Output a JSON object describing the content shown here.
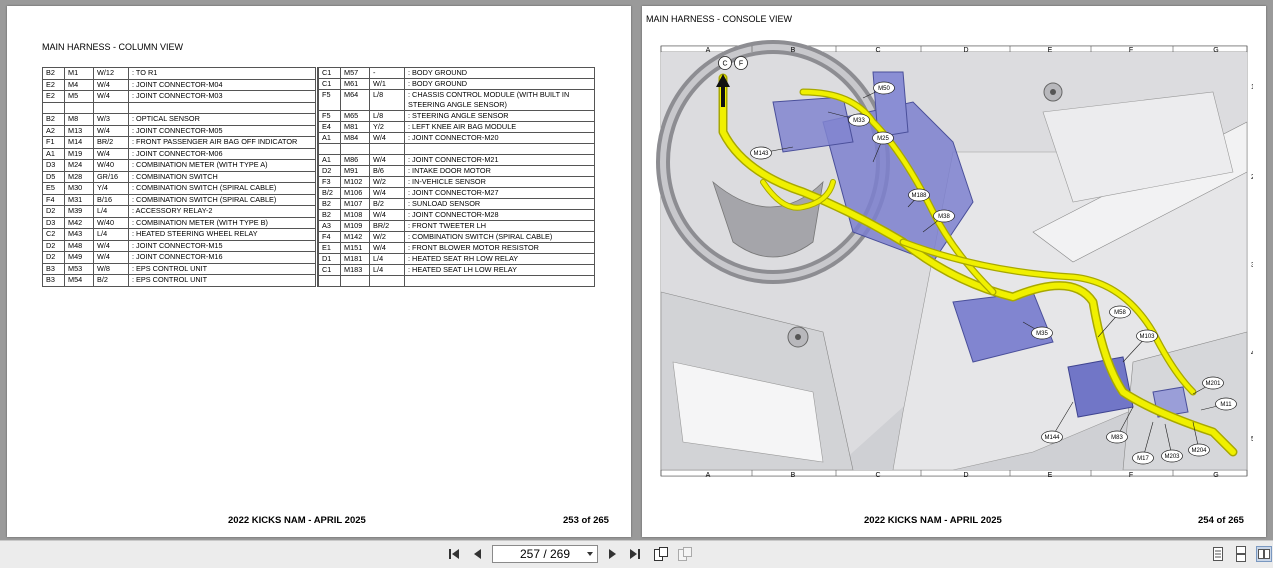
{
  "left_page": {
    "title": "MAIN HARNESS - COLUMN VIEW",
    "footer_title": "2022 KICKS NAM - APRIL 2025",
    "footer_page": "253 of 265",
    "table_left": [
      [
        "B2",
        "M1",
        "W/12",
        ": TO R1"
      ],
      [
        "E2",
        "M4",
        "W/4",
        ": JOINT CONNECTOR-M04"
      ],
      [
        "E2",
        "M5",
        "W/4",
        ": JOINT CONNECTOR-M03"
      ],
      [
        "",
        "",
        "",
        ""
      ],
      [
        "B2",
        "M8",
        "W/3",
        ": OPTICAL SENSOR"
      ],
      [
        "A2",
        "M13",
        "W/4",
        ": JOINT CONNECTOR-M05"
      ],
      [
        "F1",
        "M14",
        "BR/2",
        ": FRONT PASSENGER AIR BAG OFF INDICATOR"
      ],
      [
        "A1",
        "M19",
        "W/4",
        ": JOINT CONNECTOR-M06"
      ],
      [
        "D3",
        "M24",
        "W/40",
        ": COMBINATION METER (WITH TYPE A)"
      ],
      [
        "D5",
        "M28",
        "GR/16",
        ": COMBINATION SWITCH"
      ],
      [
        "E5",
        "M30",
        "Y/4",
        ": COMBINATION SWITCH (SPIRAL CABLE)"
      ],
      [
        "F4",
        "M31",
        "B/16",
        ": COMBINATION SWITCH (SPIRAL CABLE)"
      ],
      [
        "D2",
        "M39",
        "L/4",
        ": ACCESSORY RELAY-2"
      ],
      [
        "D3",
        "M42",
        "W/40",
        ": COMBINATION METER (WITH TYPE B)"
      ],
      [
        "C2",
        "M43",
        "L/4",
        ": HEATED STEERING WHEEL RELAY"
      ],
      [
        "D2",
        "M48",
        "W/4",
        ": JOINT CONNECTOR-M15"
      ],
      [
        "D2",
        "M49",
        "W/4",
        ": JOINT CONNECTOR-M16"
      ],
      [
        "B3",
        "M53",
        "W/8",
        ": EPS CONTROL UNIT"
      ],
      [
        "B3",
        "M54",
        "B/2",
        ": EPS CONTROL UNIT"
      ]
    ],
    "table_right": [
      [
        "C1",
        "M57",
        "-",
        ": BODY GROUND"
      ],
      [
        "C1",
        "M61",
        "W/1",
        ": BODY GROUND"
      ],
      [
        "F5",
        "M64",
        "L/8",
        ": CHASSIS CONTROL MODULE (WITH BUILT IN STEERING ANGLE SENSOR)"
      ],
      [
        "F5",
        "M65",
        "L/8",
        ": STEERING ANGLE SENSOR"
      ],
      [
        "E4",
        "M81",
        "Y/2",
        ": LEFT KNEE AIR BAG MODULE"
      ],
      [
        "A1",
        "M84",
        "W/4",
        ": JOINT CONNECTOR-M20"
      ],
      [
        "",
        "",
        "",
        ""
      ],
      [
        "A1",
        "M86",
        "W/4",
        ": JOINT CONNECTOR-M21"
      ],
      [
        "D2",
        "M91",
        "B/6",
        ": INTAKE DOOR MOTOR"
      ],
      [
        "F3",
        "M102",
        "W/2",
        ": IN-VEHICLE SENSOR"
      ],
      [
        "B/2",
        "M106",
        "W/4",
        ": JOINT CONNECTOR-M27"
      ],
      [
        "B2",
        "M107",
        "B/2",
        ": SUNLOAD SENSOR"
      ],
      [
        "B2",
        "M108",
        "W/4",
        ": JOINT CONNECTOR-M28"
      ],
      [
        "A3",
        "M109",
        "BR/2",
        ": FRONT TWEETER LH"
      ],
      [
        "F4",
        "M142",
        "W/2",
        ": COMBINATION SWITCH (SPIRAL CABLE)"
      ],
      [
        "E1",
        "M151",
        "W/4",
        ": FRONT BLOWER MOTOR RESISTOR"
      ],
      [
        "D1",
        "M181",
        "L/4",
        ": HEATED SEAT RH LOW RELAY"
      ],
      [
        "C1",
        "M183",
        "L/4",
        ": HEATED SEAT LH LOW RELAY"
      ],
      [
        "",
        "",
        "",
        ""
      ]
    ]
  },
  "right_page": {
    "title": "MAIN HARNESS - CONSOLE VIEW",
    "footer_title": "2022 KICKS NAM - APRIL 2025",
    "footer_page": "254 of 265",
    "columns": [
      "A",
      "B",
      "C",
      "D",
      "E",
      "F",
      "G"
    ],
    "rows": [
      "1",
      "2",
      "3",
      "4",
      "5"
    ],
    "view_markers": [
      "C",
      "F"
    ],
    "connector_labels": [
      "M50",
      "M33",
      "M25",
      "M143",
      "M188",
      "M38",
      "M58",
      "M35",
      "M103",
      "M201",
      "M11",
      "M144",
      "M83",
      "M204",
      "M17",
      "M203"
    ]
  },
  "toolbar": {
    "page_indicator": "257 / 269",
    "icons": [
      "first-page-icon",
      "prev-page-icon",
      "next-page-icon",
      "last-page-icon",
      "rotate-icon",
      "rotate-disabled-icon",
      "single-page-icon",
      "continuous-page-icon",
      "two-page-icon"
    ]
  },
  "colors": {
    "harness": "#f0f000",
    "harness_outline": "#a8a800",
    "component": "#6f74c8",
    "viewer_bg": "#9a9a9a",
    "toolbar_bg": "#ececec"
  }
}
